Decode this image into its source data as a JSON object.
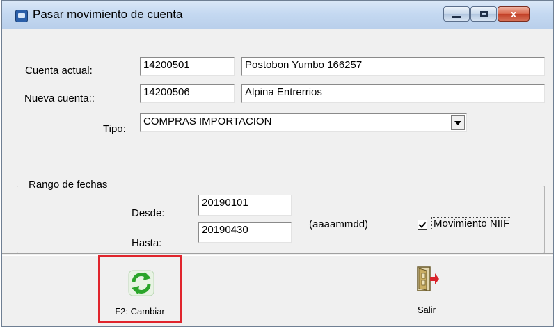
{
  "window": {
    "title": "Pasar movimiento de cuenta",
    "close_label": "x"
  },
  "form": {
    "cuenta_actual": {
      "label": "Cuenta actual:",
      "code": "14200501",
      "name": "Postobon Yumbo 166257"
    },
    "nueva_cuenta": {
      "label": "Nueva cuenta::",
      "code": "14200506",
      "name": "Alpina Entrerrios"
    },
    "tipo": {
      "label": "Tipo:",
      "value": "COMPRAS IMPORTACION"
    }
  },
  "rango": {
    "legend": "Rango de fechas",
    "desde": {
      "label": "Desde:",
      "value": "20190101"
    },
    "hasta": {
      "label": "Hasta:",
      "value": "20190430"
    },
    "format_hint": "(aaaammdd)"
  },
  "niif": {
    "label": "Movimiento NIIF",
    "checked": true
  },
  "toolbar": {
    "cambiar": {
      "label": "F2: Cambiar",
      "icon": "refresh-icon"
    },
    "salir": {
      "label": "Salir",
      "icon": "exit-door-icon"
    }
  },
  "colors": {
    "highlight": "#e0242c",
    "refresh_green": "#2aa52a"
  }
}
